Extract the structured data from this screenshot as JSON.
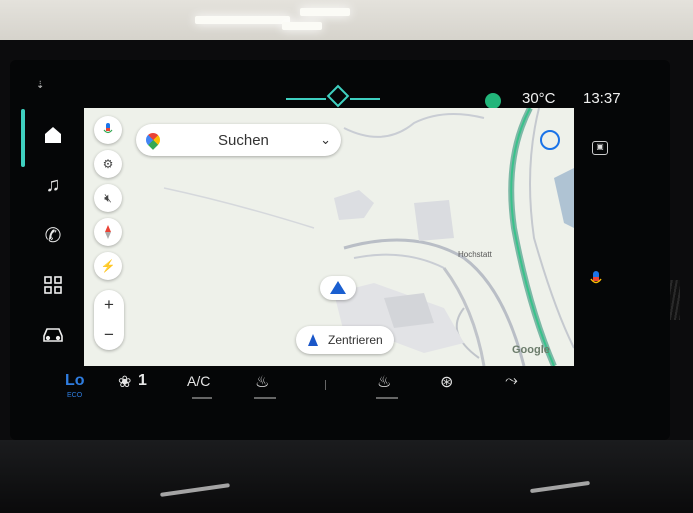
{
  "topbar": {
    "temperature": "30°C",
    "time": "13:37"
  },
  "left_nav": {
    "items": [
      "home-icon",
      "music-icon",
      "phone-icon",
      "apps-icon",
      "car-icon"
    ]
  },
  "map": {
    "search_placeholder": "Suchen",
    "recenter_label": "Zentrieren",
    "place_label": "Hochstatt",
    "zoom_in": "+",
    "zoom_out": "−",
    "attribution": "Google"
  },
  "climate": {
    "mode": "Lo",
    "mode_sub": "ECO",
    "fan_speed": "1",
    "ac_label": "A/C"
  },
  "colors": {
    "accent": "#3fd0c0",
    "nav_blue": "#1a5fd0",
    "map_bg": "#eef1ea"
  }
}
